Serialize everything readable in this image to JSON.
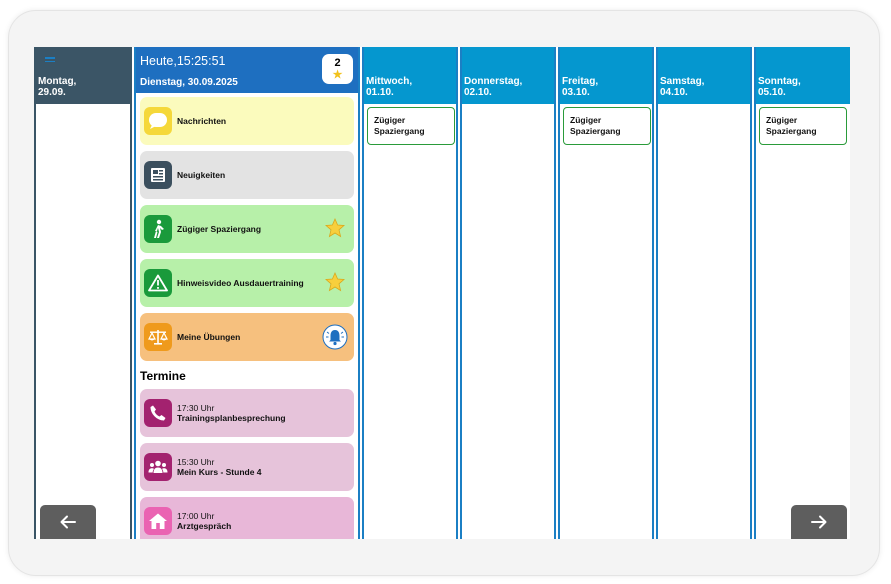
{
  "monday": {
    "day": "Montag,",
    "date": "29.09."
  },
  "today": {
    "clock": "Heute,15:25:51",
    "date": "Dienstag, 30.09.2025",
    "badge_count": "2",
    "tiles": [
      {
        "label": "Nachrichten",
        "color": "#fbfbbd",
        "icon": "speech-bubble-icon"
      },
      {
        "label": "Neuigkeiten",
        "color": "#e3e3e3",
        "icon": "newspaper-icon"
      },
      {
        "label": "Zügiger Spaziergang",
        "color": "#b7f0a9",
        "icon": "walking-person-icon",
        "starred": true
      },
      {
        "label": "Hinweisvideo Ausdauertraining",
        "color": "#b7f0a9",
        "icon": "warning-icon",
        "starred": true
      },
      {
        "label": "Meine Übungen",
        "color": "#f6c07e",
        "icon": "scale-icon",
        "bell": true
      }
    ],
    "termine_title": "Termine",
    "appointments": [
      {
        "time": "17:30 Uhr",
        "title": "Trainingsplanbesprechung",
        "icon": "phone-icon"
      },
      {
        "time": "15:30 Uhr",
        "title": "Mein Kurs - Stunde 4",
        "icon": "group-icon"
      },
      {
        "time": "17:00 Uhr",
        "title": "Arztgespräch",
        "icon": "house-icon"
      }
    ]
  },
  "days": [
    {
      "day": "Mittwoch,",
      "date": "01.10.",
      "event": [
        "Zügiger",
        "Spaziergang"
      ]
    },
    {
      "day": "Donnerstag,",
      "date": "02.10.",
      "event": null
    },
    {
      "day": "Freitag,",
      "date": "03.10.",
      "event": [
        "Zügiger",
        "Spaziergang"
      ]
    },
    {
      "day": "Samstag,",
      "date": "04.10.",
      "event": null
    },
    {
      "day": "Sonntag,",
      "date": "05.10.",
      "event": [
        "Zügiger",
        "Spaziergang"
      ]
    }
  ],
  "colors": {
    "header_blue": "#0597cf",
    "today_blue": "#1e6fc0",
    "monday_dark": "#3b5566",
    "event_border": "#2a9b3a",
    "appointment_pink": "#e6c3da"
  },
  "nav": {
    "prev": "arrow-left-icon",
    "next": "arrow-right-icon"
  }
}
